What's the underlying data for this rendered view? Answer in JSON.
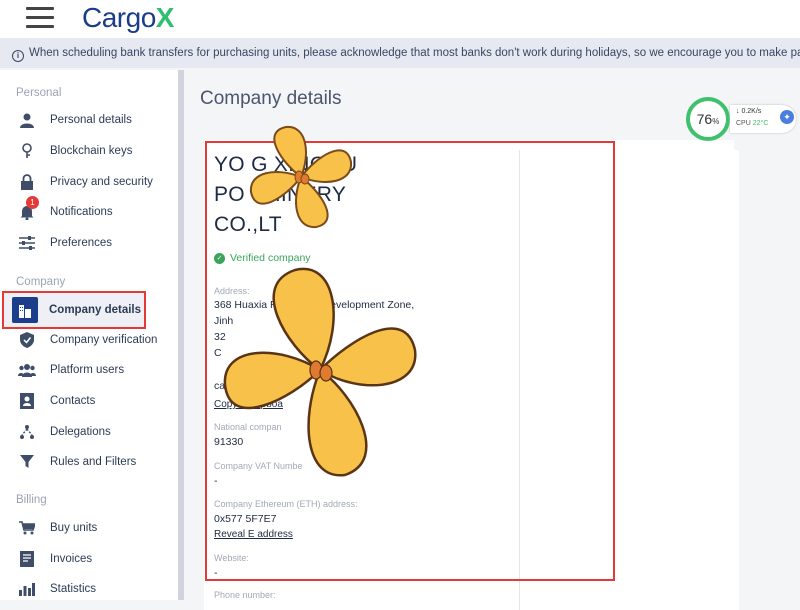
{
  "header": {
    "logo_text": "Cargo",
    "logo_accent": "X",
    "brand_color": "#1b3b8b",
    "accent_color": "#2fbf71"
  },
  "notice": {
    "icon": "info-icon",
    "text": "When scheduling bank transfers for purchasing units, please acknowledge that most banks don't work during holidays, so we encourage you to make payments ea"
  },
  "sidebar": {
    "sections": [
      {
        "label": "Personal",
        "items": [
          {
            "label": "Personal details",
            "icon": "person-icon"
          },
          {
            "label": "Blockchain keys",
            "icon": "key-icon"
          },
          {
            "label": "Privacy and security",
            "icon": "lock-icon"
          },
          {
            "label": "Notifications",
            "icon": "bell-icon",
            "badge": "1"
          },
          {
            "label": "Preferences",
            "icon": "sliders-icon"
          }
        ]
      },
      {
        "label": "Company",
        "items": [
          {
            "label": "Company details",
            "icon": "building-icon",
            "active": true
          },
          {
            "label": "Company verification",
            "icon": "shield-icon"
          },
          {
            "label": "Platform users",
            "icon": "users-icon"
          },
          {
            "label": "Contacts",
            "icon": "contacts-icon"
          },
          {
            "label": "Delegations",
            "icon": "delegation-icon"
          },
          {
            "label": "Rules and Filters",
            "icon": "filter-icon"
          }
        ]
      },
      {
        "label": "Billing",
        "items": [
          {
            "label": "Buy units",
            "icon": "cart-icon"
          },
          {
            "label": "Invoices",
            "icon": "invoice-icon"
          },
          {
            "label": "Statistics",
            "icon": "chart-icon"
          }
        ]
      }
    ]
  },
  "main": {
    "title": "Company details",
    "company": {
      "name_line1": "YO     G XINGHU",
      "name_line2": "PO           SHINERY",
      "name_line3": "CO.,LT",
      "verified_label": "Verified company",
      "address_label": "Address:",
      "address_line1": "368 Huaxia R          conomic Development Zone,",
      "address_line2": "Jinh",
      "address_line3": "32",
      "address_line4": "C",
      "address_line5": "cae",
      "copy_link": "Copy to clipboa",
      "national_label": "National compan",
      "national_value": "91330",
      "vat_label": "Company VAT Numbe",
      "vat_value": "-",
      "eth_label": "Company Ethereum (ETH) address:",
      "eth_value": "0x577         5F7E7",
      "reveal_link": "Reveal E     address",
      "website_label": "Website:",
      "website_value": "-",
      "phone_label": "Phone number:"
    }
  },
  "perf_widget": {
    "percent": "76",
    "percent_unit": "%",
    "net": "0.2K/s",
    "cpu_label": "CPU",
    "cpu_temp": "22°C"
  }
}
